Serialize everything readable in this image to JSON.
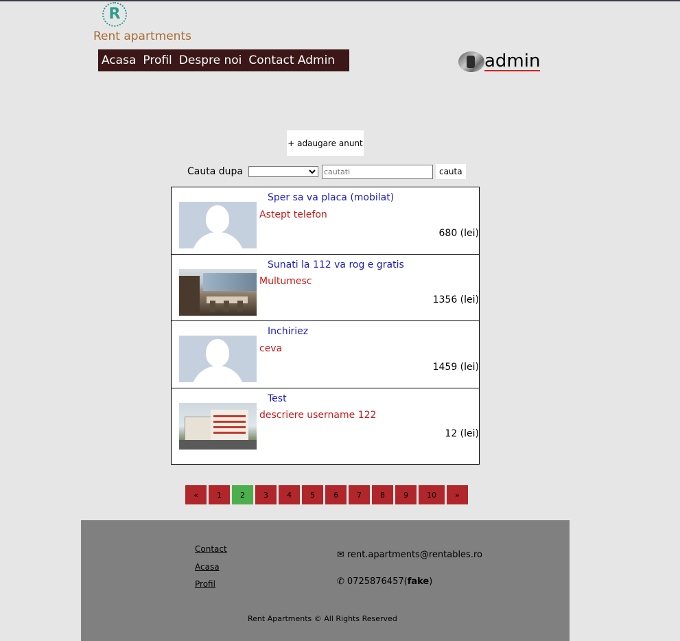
{
  "brand": {
    "logo_letter": "R",
    "name": "Rent apartments"
  },
  "nav": {
    "items": [
      "Acasa",
      "Profil",
      "Despre noi",
      "Contact Admin"
    ]
  },
  "user": {
    "username": "admin"
  },
  "actions": {
    "add_label": "+ adaugare anunt"
  },
  "search": {
    "label": "Cauta dupa",
    "selected": "",
    "placeholder": "cautati",
    "button": "cauta"
  },
  "listings": [
    {
      "title": "Sper sa va placa (mobilat)",
      "description": "Astept telefon",
      "price": "680 (lei)",
      "image": "placeholder"
    },
    {
      "title": "Sunati la 112 va rog e gratis",
      "description": "Multumesc",
      "price": "1356 (lei)",
      "image": "interior"
    },
    {
      "title": "Inchiriez",
      "description": "ceva",
      "price": "1459 (lei)",
      "image": "placeholder"
    },
    {
      "title": "Test",
      "description": "descriere username 122",
      "price": "12 (lei)",
      "image": "building"
    }
  ],
  "pagination": {
    "prev": "«",
    "pages": [
      "1",
      "2",
      "3",
      "4",
      "5",
      "6",
      "7",
      "8",
      "9",
      "10"
    ],
    "active": "2",
    "next": "»"
  },
  "footer": {
    "links": [
      "Contact",
      "Acasa",
      "Profil"
    ],
    "email": "rent.apartments@rentables.ro",
    "phone": "0725876457",
    "phone_note": "fake",
    "copyright": "Rent Apartments © All Rights Reserved"
  },
  "colors": {
    "nav_bg": "#3b1717",
    "page_bg": "#e6e6e6",
    "pagination_bg": "#b0262a",
    "pagination_active": "#4cae4c",
    "footer_bg": "#808080",
    "title_color": "#1a1ac8",
    "desc_color": "#c61a1a"
  }
}
